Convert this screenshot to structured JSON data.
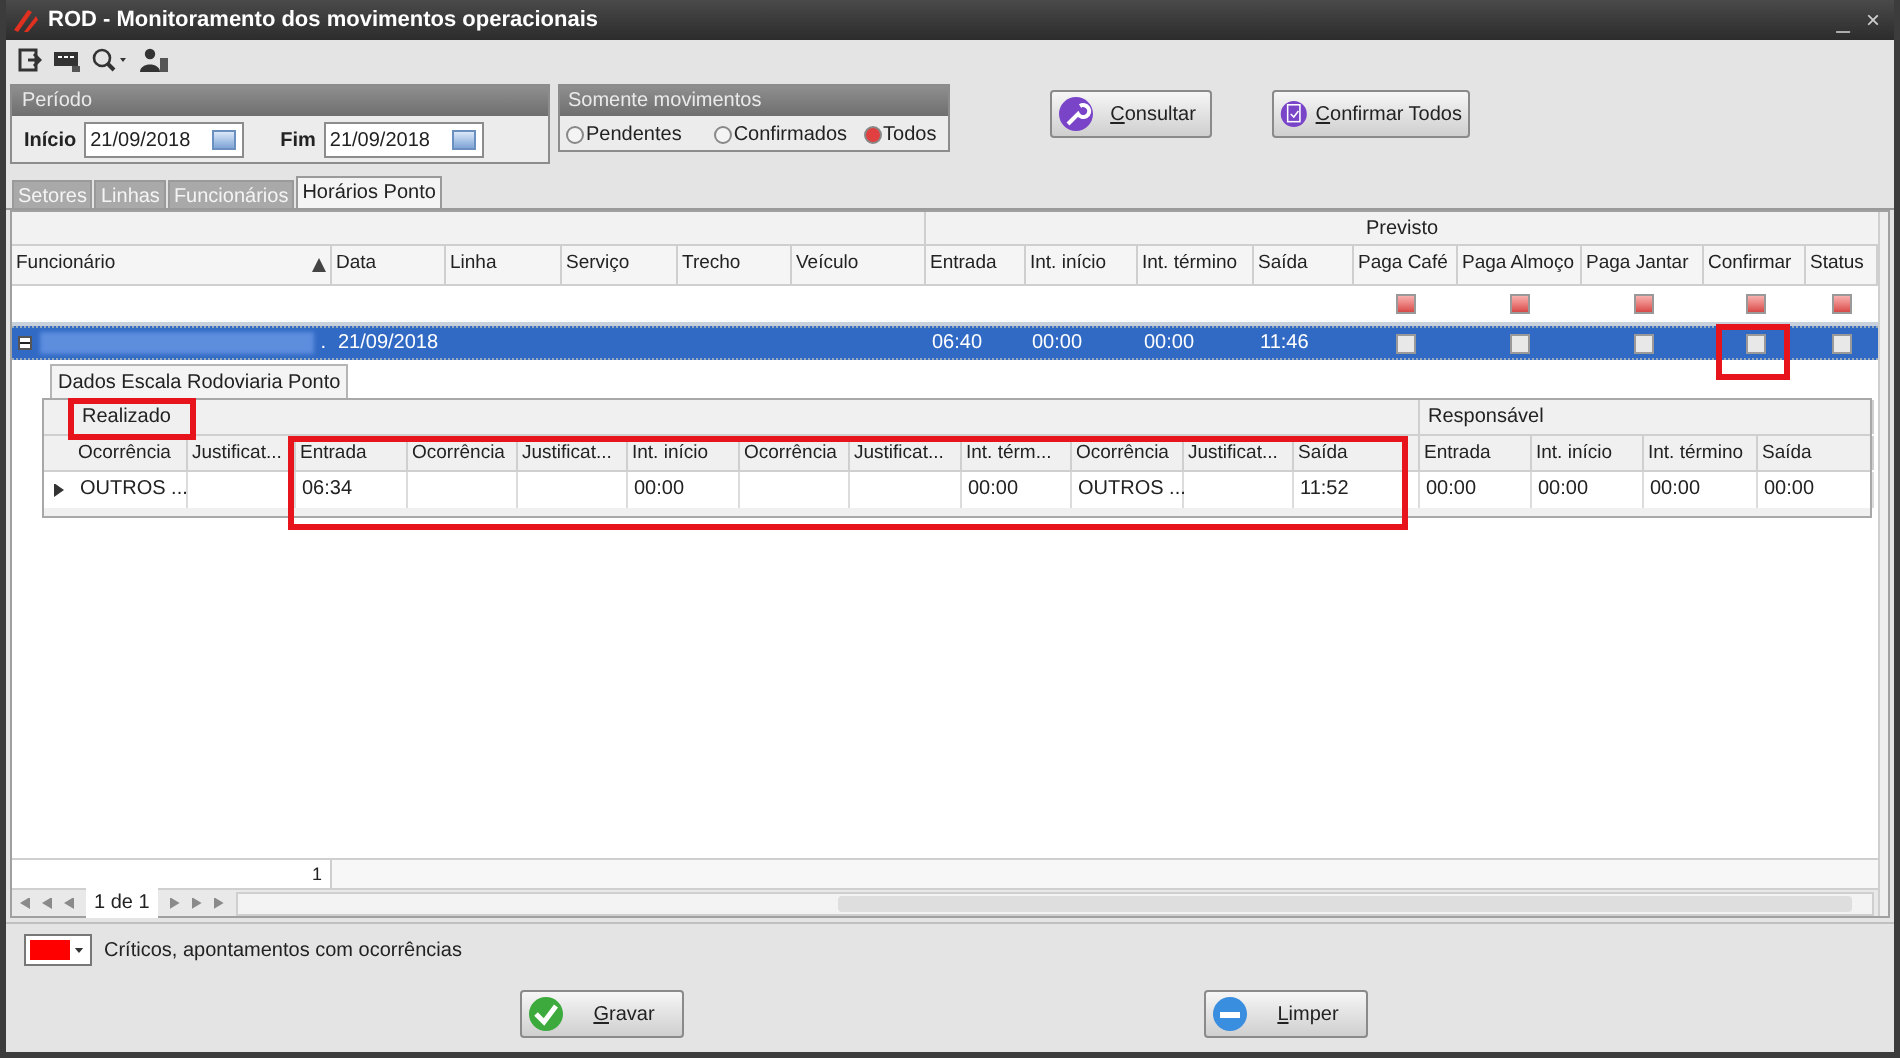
{
  "window": {
    "title": "ROD - Monitoramento dos movimentos operacionais",
    "buttons": [
      "_",
      "×"
    ]
  },
  "period": {
    "title": "Período",
    "start": {
      "label": "Início",
      "value": "21/09/2018"
    },
    "end": {
      "label": "Fim",
      "value": "21/09/2018"
    }
  },
  "movement_filter": {
    "title": "Somente movimentos",
    "options": [
      {
        "label": "Pendentes",
        "selected": false
      },
      {
        "label": "Confirmados",
        "selected": false
      },
      {
        "label": "Todos",
        "selected": true
      }
    ]
  },
  "actions_top": [
    "Consultar",
    "Confirmar Todos"
  ],
  "tabs": [
    {
      "label": "Setores",
      "selected": false
    },
    {
      "label": "Linhas",
      "selected": false
    },
    {
      "label": "Funcionários",
      "selected": false
    },
    {
      "label": "Horários Ponto",
      "selected": true
    }
  ],
  "grid": {
    "group_header": "Previsto",
    "columns": [
      {
        "label": "Funcionário",
        "kind": "text",
        "sorted_ascending": true
      },
      {
        "label": "Data",
        "kind": "text"
      },
      {
        "label": "Linha",
        "kind": "text"
      },
      {
        "label": "Serviço",
        "kind": "text"
      },
      {
        "label": "Trecho",
        "kind": "text"
      },
      {
        "label": "Veículo",
        "kind": "text"
      },
      {
        "label": "Entrada",
        "kind": "text"
      },
      {
        "label": "Int. início",
        "kind": "text"
      },
      {
        "label": "Int. término",
        "kind": "text"
      },
      {
        "label": "Saída",
        "kind": "text"
      },
      {
        "label": "Paga Café",
        "kind": "check"
      },
      {
        "label": "Paga Almoço",
        "kind": "check"
      },
      {
        "label": "Paga Jantar",
        "kind": "check"
      },
      {
        "label": "Confirmar",
        "kind": "check"
      },
      {
        "label": "Status",
        "kind": "check"
      }
    ],
    "rows": [
      {
        "selected": true,
        "expanded": true,
        "redacted_name": true,
        "cells": [
          ".",
          "21/09/2018",
          null,
          null,
          null,
          null,
          "06:40",
          "00:00",
          "00:00",
          "11:46",
          false,
          false,
          false,
          false,
          false
        ]
      }
    ],
    "footer_count": "1",
    "pager": "1 de 1"
  },
  "detail": {
    "tab": "Dados Escala Rodoviaria Ponto",
    "groups": [
      {
        "label": "Realizado",
        "columns": [
          "Ocorrência",
          "Justificat...",
          "Entrada",
          "Ocorrência",
          "Justificat...",
          "Int. início",
          "Ocorrência",
          "Justificat...",
          "Int. térm...",
          "Ocorrência",
          "Justificat...",
          "Saída"
        ]
      },
      {
        "label": "Responsável",
        "columns": [
          "Entrada",
          "Int. início",
          "Int. término",
          "Saída"
        ]
      }
    ],
    "rows": [
      {
        "current": true,
        "cells": [
          "OUTROS ...",
          null,
          "06:34",
          null,
          null,
          "00:00",
          null,
          null,
          "00:00",
          "OUTROS ...",
          null,
          "11:52",
          "00:00",
          "00:00",
          "00:00",
          "00:00"
        ]
      }
    ]
  },
  "legend": {
    "color": "#ff0000",
    "label": "Críticos, apontamentos com ocorrências"
  },
  "actions_bottom": [
    {
      "label": "Gravar",
      "kind": "save"
    },
    {
      "label": "Limper",
      "kind": "clear"
    }
  ]
}
